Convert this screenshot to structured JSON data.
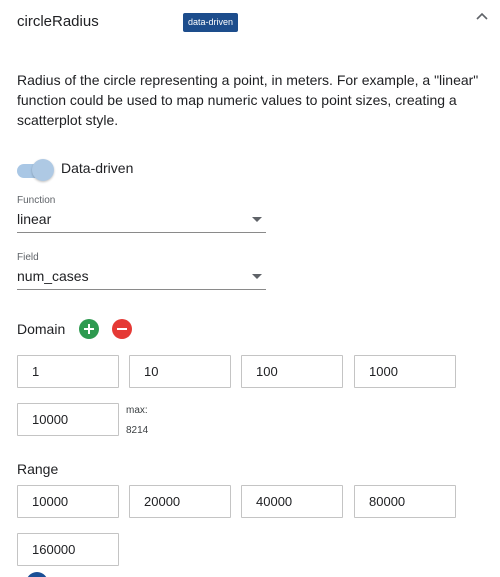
{
  "header": {
    "property_name": "circleRadius",
    "badge": "data-driven",
    "collapse_icon": "chevron-up-icon"
  },
  "description": "Radius of the circle representing a point, in meters. For example, a \"linear\" function could be used to map numeric values to point sizes, creating a scatterplot style.",
  "toggle": {
    "label": "Data-driven",
    "checked": true
  },
  "function_select": {
    "label": "Function",
    "value": "linear"
  },
  "field_select": {
    "label": "Field",
    "value": "num_cases"
  },
  "domain": {
    "title": "Domain",
    "add_icon": "plus-circle-icon",
    "remove_icon": "minus-circle-icon",
    "values": [
      "1",
      "10",
      "100",
      "1000",
      "10000"
    ],
    "max_label": "max:",
    "max_value": "8214"
  },
  "range": {
    "title": "Range",
    "values": [
      "10000",
      "20000",
      "40000",
      "80000",
      "160000"
    ]
  },
  "colors": {
    "badge": "#1d4d8c",
    "add": "#2e9a50",
    "remove": "#e53935",
    "toggle_track": "#a9c7e5"
  }
}
